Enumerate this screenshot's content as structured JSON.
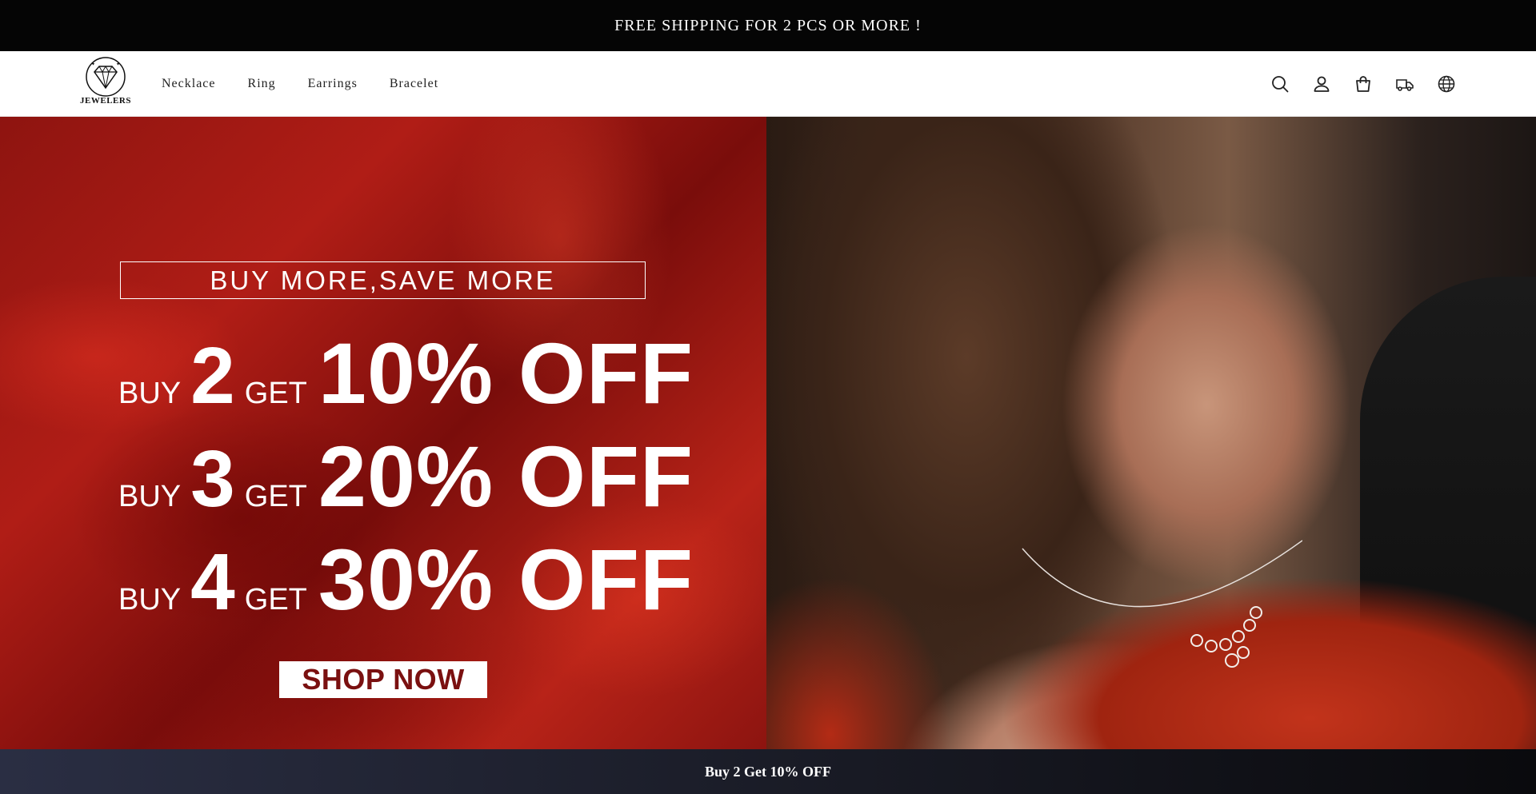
{
  "announcement": {
    "text": "FREE SHIPPING FOR 2 PCS OR MORE !"
  },
  "header": {
    "logo_text": "JEWELERS",
    "nav": [
      {
        "label": "Necklace"
      },
      {
        "label": "Ring"
      },
      {
        "label": "Earrings"
      },
      {
        "label": "Bracelet"
      }
    ],
    "icons": [
      "search-icon",
      "account-icon",
      "cart-icon",
      "track-order-icon",
      "globe-icon"
    ]
  },
  "hero": {
    "headline": "BUY MORE,SAVE MORE",
    "offers": [
      {
        "buy": "BUY",
        "qty": "2",
        "get": "GET",
        "discount": "10% OFF"
      },
      {
        "buy": "BUY",
        "qty": "3",
        "get": "GET",
        "discount": "20% OFF"
      },
      {
        "buy": "BUY",
        "qty": "4",
        "get": "GET",
        "discount": "30% OFF"
      }
    ],
    "cta": "SHOP NOW",
    "accent_color": "#b01d16"
  },
  "bottom_bar": {
    "text": "Buy 2 Get 10% OFF"
  }
}
